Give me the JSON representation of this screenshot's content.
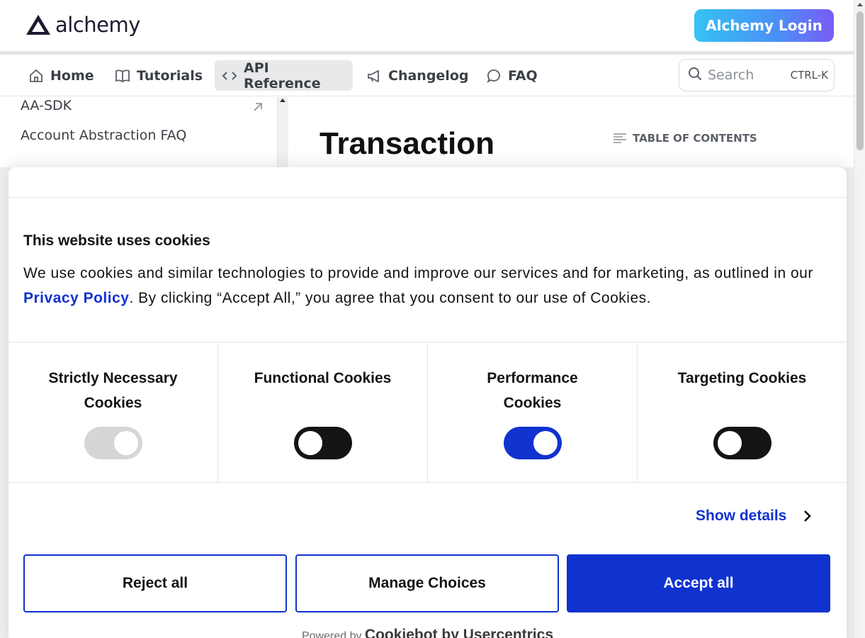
{
  "header": {
    "logo_text": "alchemy",
    "login_label": "Alchemy Login"
  },
  "nav": {
    "items": [
      {
        "label": "Home",
        "icon": "home-icon"
      },
      {
        "label": "Tutorials",
        "icon": "book-icon"
      },
      {
        "label": "API Reference",
        "icon": "code-icon",
        "active": true
      },
      {
        "label": "Changelog",
        "icon": "megaphone-icon"
      },
      {
        "label": "FAQ",
        "icon": "chat-bubble-icon"
      }
    ],
    "search_placeholder": "Search",
    "search_shortcut": "CTRL-K"
  },
  "sidebar": {
    "items": [
      {
        "label": "AA-SDK",
        "external": true
      },
      {
        "label": "Account Abstraction FAQ"
      }
    ]
  },
  "main": {
    "title": "Transaction",
    "toc_label": "TABLE OF CONTENTS"
  },
  "cookie": {
    "title": "This website uses cookies",
    "body_before": "We use cookies and similar technologies to provide and improve our services and for marketing, as outlined in our ",
    "policy_link": "Privacy Policy",
    "body_after": ". By clicking “Accept All,” you agree that you consent to our use of Cookies.",
    "categories": [
      {
        "label": "Strictly Necessary Cookies",
        "state": "on",
        "disabled": true
      },
      {
        "label": "Functional Cookies",
        "state": "off"
      },
      {
        "label": "Performance Cookies",
        "state": "on"
      },
      {
        "label": "Targeting Cookies",
        "state": "off"
      }
    ],
    "show_details": "Show details",
    "buttons": {
      "reject": "Reject all",
      "manage": "Manage Choices",
      "accept": "Accept all"
    },
    "powered_prefix": "Powered by",
    "powered_brand": "Cookiebot by Usercentrics",
    "colors": {
      "accent": "#1032cf",
      "toggle_off": "#141414",
      "toggle_disabled": "#d6d6d6"
    }
  }
}
